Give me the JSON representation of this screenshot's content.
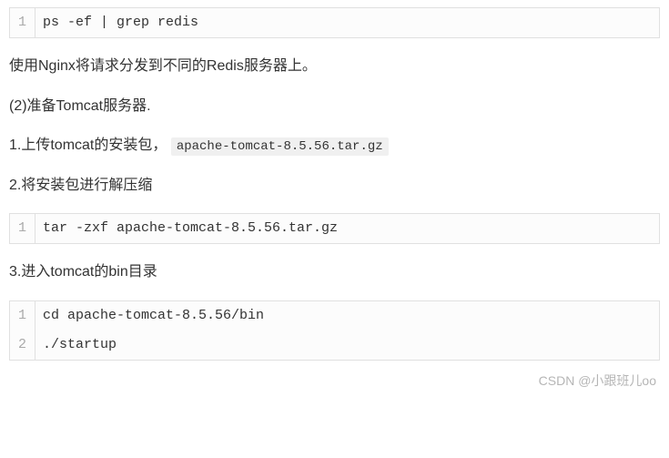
{
  "code1": {
    "lines": [
      {
        "no": "1",
        "text": "ps -ef | grep redis"
      }
    ]
  },
  "para1": "使用Nginx将请求分发到不同的Redis服务器上。",
  "para2": "(2)准备Tomcat服务器.",
  "para3_prefix": "1.上传tomcat的安装包，",
  "para3_code": "apache-tomcat-8.5.56.tar.gz",
  "para4": "2.将安装包进行解压缩",
  "code2": {
    "lines": [
      {
        "no": "1",
        "text": "tar -zxf apache-tomcat-8.5.56.tar.gz"
      }
    ]
  },
  "para5": "3.进入tomcat的bin目录",
  "code3": {
    "lines": [
      {
        "no": "1",
        "text": "cd apache-tomcat-8.5.56/bin"
      },
      {
        "no": "2",
        "text": "./startup"
      }
    ]
  },
  "watermark": "CSDN @小跟班儿oo"
}
